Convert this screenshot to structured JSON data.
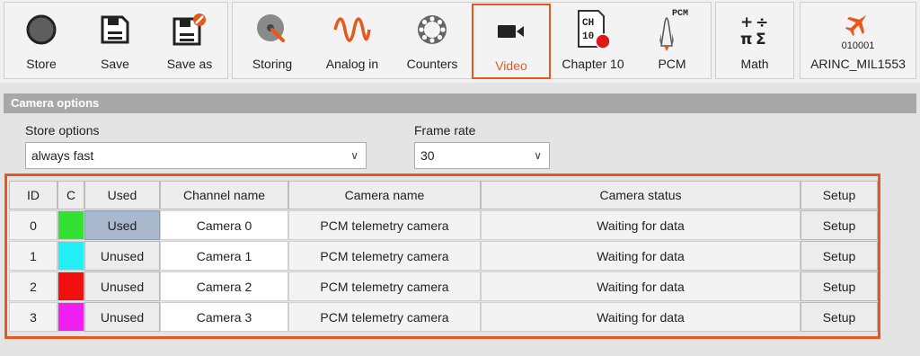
{
  "toolbar": {
    "file_group": [
      {
        "label": "Store",
        "icon": "store-icon"
      },
      {
        "label": "Save",
        "icon": "save-icon"
      },
      {
        "label": "Save as",
        "icon": "save-as-icon"
      }
    ],
    "module_group": [
      {
        "label": "Storing",
        "icon": "storing-icon"
      },
      {
        "label": "Analog in",
        "icon": "analog-in-icon"
      },
      {
        "label": "Counters",
        "icon": "counters-icon"
      },
      {
        "label": "Video",
        "icon": "video-camera-icon",
        "active": true
      },
      {
        "label": "Chapter 10",
        "icon": "chapter-10-icon",
        "icon_text": "CH 10"
      },
      {
        "label": "PCM",
        "icon": "pcm-icon",
        "icon_text": "PCM"
      }
    ],
    "math": {
      "label": "Math",
      "icon": "math-icon",
      "icon_text": "+ ÷ π Σ"
    },
    "arinc": {
      "label": "ARINC_MIL1553",
      "icon": "arinc-icon",
      "icon_text": "010001"
    },
    "active_color": "#e8581c"
  },
  "panel": {
    "title": "Camera options",
    "store_options": {
      "label": "Store options",
      "value": "always fast"
    },
    "frame_rate": {
      "label": "Frame rate",
      "value": "30"
    }
  },
  "table": {
    "headers": [
      "ID",
      "C",
      "Used",
      "Channel name",
      "Camera name",
      "Camera status",
      "Setup"
    ],
    "rows": [
      {
        "id": "0",
        "color": "#33e133",
        "used": "Used",
        "channel": "Camera 0",
        "camera": "PCM telemetry camera",
        "status": "Waiting for data",
        "setup": "Setup"
      },
      {
        "id": "1",
        "color": "#22eef5",
        "used": "Unused",
        "channel": "Camera 1",
        "camera": "PCM telemetry camera",
        "status": "Waiting for data",
        "setup": "Setup"
      },
      {
        "id": "2",
        "color": "#f20f0f",
        "used": "Unused",
        "channel": "Camera 2",
        "camera": "PCM telemetry camera",
        "status": "Waiting for data",
        "setup": "Setup"
      },
      {
        "id": "3",
        "color": "#f01ef0",
        "used": "Unused",
        "channel": "Camera 3",
        "camera": "PCM telemetry camera",
        "status": "Waiting for data",
        "setup": "Setup"
      }
    ]
  }
}
